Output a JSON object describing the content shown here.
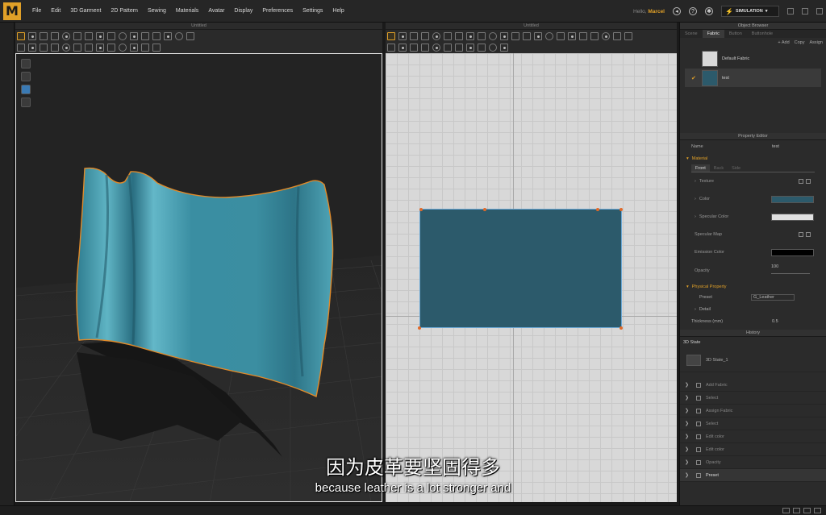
{
  "app": {
    "logo": "M",
    "menu": [
      "File",
      "Edit",
      "3D Garment",
      "2D Pattern",
      "Sewing",
      "Materials",
      "Avatar",
      "Display",
      "Preferences",
      "Settings",
      "Help"
    ],
    "user_prefix": "Hello,",
    "user_name": "Marcel",
    "mode_label": "SIMULATION"
  },
  "viewport3d": {
    "title": "Untitled"
  },
  "viewport2d": {
    "title": "Untitled"
  },
  "object_browser": {
    "title": "Object Browser",
    "tabs": [
      "Scene",
      "Fabric",
      "Button",
      "Buttonhole"
    ],
    "active_tab": "Fabric",
    "actions": [
      "+ Add",
      "Copy",
      "Assign"
    ],
    "items": [
      {
        "label": "Default Fabric",
        "color": "#d9d9d9",
        "selected": false
      },
      {
        "label": "test",
        "color": "#2c5a6b",
        "selected": true
      }
    ]
  },
  "property_editor": {
    "title": "Property Editor",
    "name_label": "Name",
    "name_value": "test",
    "material_section": "Material",
    "subtabs": [
      "Front",
      "Back",
      "Side"
    ],
    "props": {
      "texture": "Texture",
      "color": "Color",
      "color_value": "#2c5a6b",
      "specular_color": "Specular Color",
      "specular_value": "#e0e0e0",
      "specular_map": "Specular Map",
      "emission_color": "Emission Color",
      "emission_value": "#000000",
      "opacity": "Opacity",
      "opacity_value": "100"
    },
    "physical_section": "Physical Property",
    "preset_label": "Preset",
    "preset_value": "G_Leather",
    "detail_label": "Detail",
    "thickness_label": "Thickness (mm)",
    "thickness_value": "0.5"
  },
  "history": {
    "title": "History",
    "state_label": "3D State",
    "state_item": "3D State_1",
    "items": [
      "Add Fabric",
      "Select",
      "Assign Fabric",
      "Select",
      "Edit color",
      "Edit color",
      "Opacity",
      "Preset"
    ]
  },
  "subtitles": {
    "cn": "因为皮革要坚固得多",
    "en": "because leather is a lot stronger and"
  }
}
